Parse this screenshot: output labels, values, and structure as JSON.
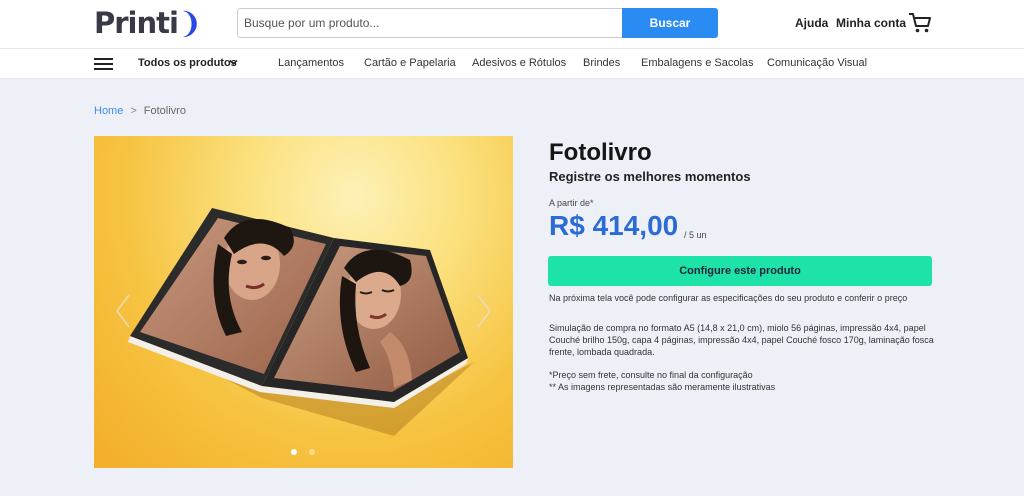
{
  "header": {
    "logo_text": "Printi",
    "search": {
      "placeholder": "Busque por um produto...",
      "value": "",
      "button_label": "Buscar"
    },
    "links": {
      "help": "Ajuda",
      "account": "Minha conta"
    },
    "cart_icon": "shopping-cart-icon"
  },
  "nav": {
    "menu_icon": "hamburger-menu-icon",
    "all_products": "Todos os produtos",
    "items": [
      {
        "label": "Lançamentos"
      },
      {
        "label": "Cartão e Papelaria"
      },
      {
        "label": "Adesivos e Rótulos"
      },
      {
        "label": "Brindes"
      },
      {
        "label": "Embalagens e Sacolas"
      },
      {
        "label": "Comunicação Visual"
      }
    ]
  },
  "breadcrumb": {
    "home": "Home",
    "separator": ">",
    "current": "Fotolivro"
  },
  "gallery": {
    "prev_icon": "chevron-left-icon",
    "next_icon": "chevron-right-icon",
    "slide_count": 2,
    "active_slide": 1
  },
  "product": {
    "title": "Fotolivro",
    "subtitle": "Registre os melhores momentos",
    "price_label": "A partir de*",
    "price": "R$ 414,00",
    "price_unit": "/ 5 un",
    "cta_label": "Configure este produto",
    "cta_note": "Na próxima tela você pode configurar as especificações do seu produto e conferir o preço",
    "spec_text": "Simulação de compra no formato A5 (14,8 x 21,0 cm), miolo 56 páginas, impressão 4x4, papel Couché brilho 150g, capa 4 páginas, impressão 4x4, papel Couché fosco 170g, laminação fosca frente, lombada quadrada.",
    "footnote_1": "*Preço sem frete, consulte no final da configuração",
    "footnote_2": "** As imagens representadas são meramente ilustrativas"
  },
  "colors": {
    "brand": "#2a47e5",
    "search_button": "#2a8bf2",
    "price": "#2a6bd6",
    "cta": "#1ee3a9",
    "page_bg": "#eef0f7",
    "gallery_bg": "#f6c442"
  }
}
